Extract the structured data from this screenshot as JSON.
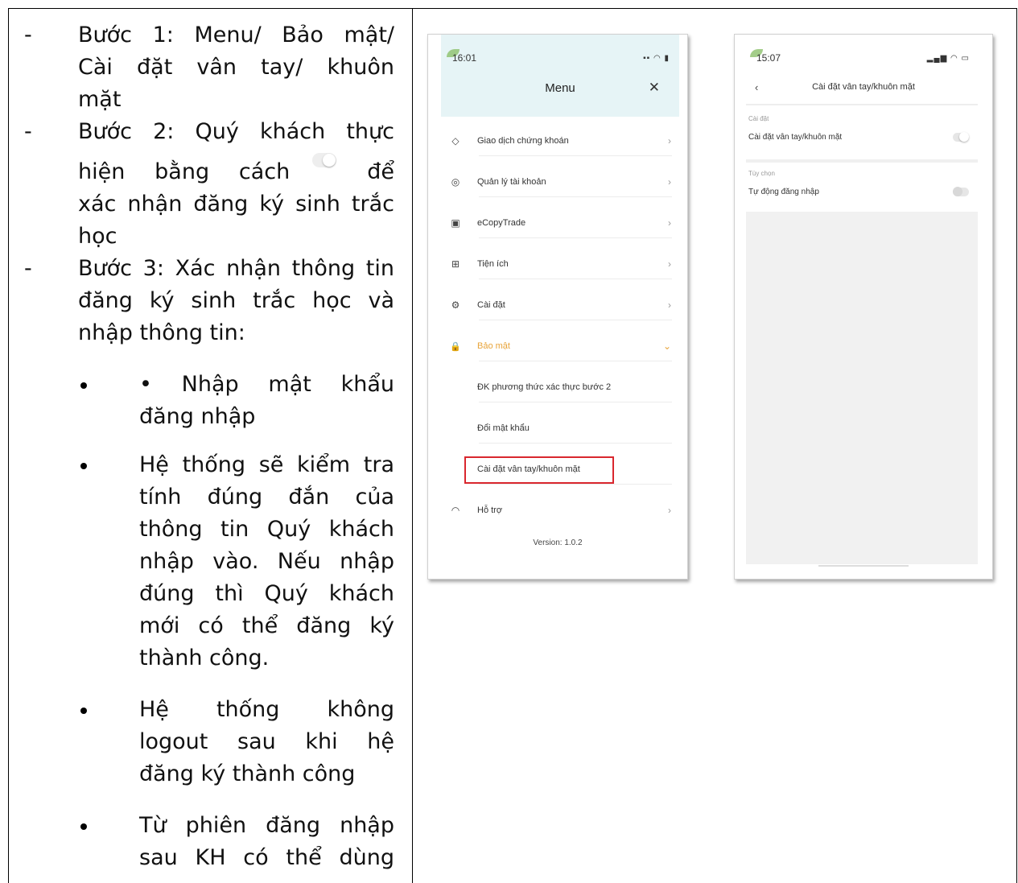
{
  "left_column": {
    "dash": "-",
    "steps": [
      {
        "lines": [
          "Bước 1: Menu/ Bảo mật/",
          "Cài đặt vân tay/ khuôn",
          "mặt"
        ]
      },
      {
        "line1": "Bước 2: Quý khách thực",
        "line2_pre": "hiện bằng cách",
        "line2_post": "để",
        "line3": "xác nhận đăng ký sinh trắc",
        "line4": "học"
      },
      {
        "lines": [
          "Bước 3: Xác nhận thông tin",
          "đăng ký sinh trắc học và",
          "nhập thông tin:"
        ]
      }
    ],
    "bullets": [
      {
        "lines": [
          "• Nhập mật khẩu",
          "đăng nhập"
        ]
      },
      {
        "lines": [
          "Hệ thống sẽ kiểm tra",
          "tính đúng đắn của",
          "thông tin Quý khách",
          "nhập vào. Nếu nhập",
          "đúng thì Quý khách",
          "mới có thể đăng ký",
          "thành công."
        ]
      },
      {
        "lines": [
          "Hệ thống không",
          "logout sau khi hệ",
          "đăng ký thành công"
        ]
      },
      {
        "lines": [
          "Từ phiên đăng nhập",
          "sau KH có thể dùng"
        ]
      }
    ]
  },
  "phone1": {
    "status_time": "16:01",
    "title": "Menu",
    "close": "✕",
    "items": [
      {
        "icon": "◇",
        "label": "Giao dịch chứng khoán",
        "chev": "›"
      },
      {
        "icon": "◎",
        "label": "Quản lý tài khoản",
        "chev": "›"
      },
      {
        "icon": "▣",
        "label": "eCopyTrade",
        "chev": "›"
      },
      {
        "icon": "⊞",
        "label": "Tiện ích",
        "chev": "›"
      },
      {
        "icon": "⚙",
        "label": "Cài đặt",
        "chev": "›"
      },
      {
        "icon": "🔒",
        "label": "Bảo mật",
        "chev": "⌄"
      },
      {
        "icon": "◠",
        "label": "Hỗ trợ",
        "chev": "›"
      }
    ],
    "sub_items": [
      "ĐK phương thức xác thực bước 2",
      "Đổi mật khẩu",
      "Cài đặt vân tay/khuôn mặt"
    ],
    "version": "Version: 1.0.2",
    "accent_color": "#e8a43a",
    "highlight_color": "#d9272e"
  },
  "phone2": {
    "status_time": "15:07",
    "back": "‹",
    "title": "Cài đặt vân tay/khuôn mặt",
    "section1": "Cài đặt",
    "row1": "Cài đặt vân tay/khuôn mặt",
    "section2": "Tùy chọn",
    "row2": "Tự động đăng nhập"
  }
}
